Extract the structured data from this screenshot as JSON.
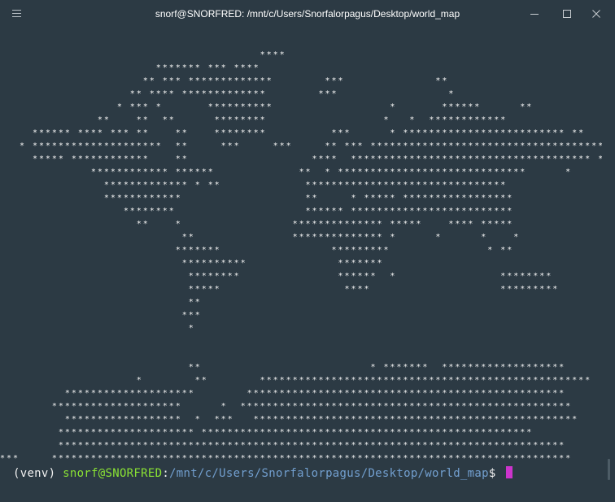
{
  "window": {
    "title": "snorf@SNORFRED: /mnt/c/Users/Snorfalorpagus/Desktop/world_map",
    "menu_icon": "hamburger-menu-icon",
    "controls": [
      "minimize-icon",
      "maximize-icon",
      "close-icon"
    ]
  },
  "colors": {
    "background": "#2c3a44",
    "text": "#f2f2f2",
    "user_host": "#8ae234",
    "path": "#729fcf",
    "cursor": "#cc34cc"
  },
  "ascii_map": {
    "lines": [
      "                                        ****",
      "                        ******* *** ****",
      "                      ** *** *************        ***              **",
      "                    ** **** *************        ***                 *",
      "                  * *** *       **********                  *       ******      **",
      "               **    **  **      ********                  *   *  ************",
      "     ****** **** *** **    **    ********          ***      * ************************* **",
      "   * ********************  **     ***     ***     ** *** ***************************************",
      "     ***** ************    **                   ****  ************************************* ***",
      "              ************ ******             **  * *****************************      *",
      "                ************* * **             *******************************",
      "                ************                   **     * ***** *****************",
      "                   ********                    ****** *************************",
      "                     **    *                 ************** *****    **** *****",
      "                            **               ************** *      *      *    *",
      "                           *******                 *********               * **",
      "                            **********              *******                                   *",
      "                             ********               ******  *                ********",
      "                             *****                   ****                    *********",
      "                             **",
      "                            ***",
      "                             *",
      "",
      "",
      "                             **                          * *******  *******************",
      "                     *        **        ***************************************************",
      "          ********************        *************************************************",
      "        ********************      *  ***************************************************",
      "          ******************  *  ***   **************************************************",
      "         ********************* ***************************************************",
      "         ******************************************************************************",
      "***     ********************************************************************************"
    ]
  },
  "prompt": {
    "venv": "(venv) ",
    "user_host": "snorf@SNORFRED",
    "colon": ":",
    "path": "/mnt/c/Users/Snorfalorpagus/Desktop/world_map",
    "dollar": "$ "
  }
}
